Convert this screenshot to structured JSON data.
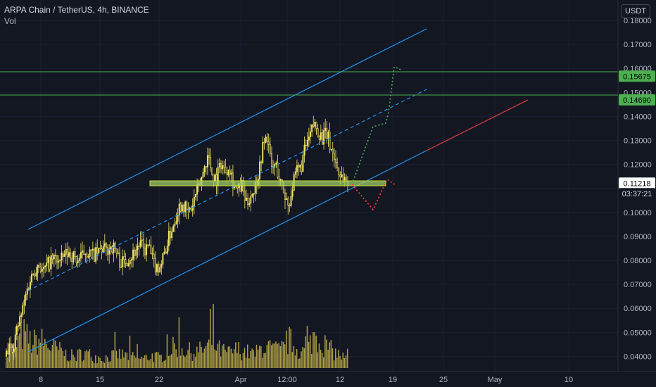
{
  "header": {
    "symbol_line": "ARPA Chain / TetherUS, 4h, BINANCE",
    "volume_label": "Vol"
  },
  "price_scale": {
    "unit": "USDT",
    "ticks": [
      "0.18000",
      "0.17000",
      "0.16000",
      "0.15000",
      "0.14000",
      "0.13000",
      "0.12000",
      "0.11000",
      "0.10000",
      "0.09000",
      "0.08000",
      "0.07000",
      "0.06000",
      "0.05000",
      "0.04000"
    ],
    "ylim": [
      0.035,
      0.18
    ]
  },
  "time_scale": {
    "ticks": [
      "8",
      "15",
      "22",
      "Apr",
      "12:00",
      "12",
      "19",
      "25",
      "May",
      "10"
    ]
  },
  "badges": [
    {
      "label": "0.15675",
      "value": 0.15675,
      "color": "#4caf50",
      "text_color": "#000000"
    },
    {
      "label": "0.14690",
      "value": 0.1469,
      "color": "#4caf50",
      "text_color": "#000000"
    },
    {
      "label": "0.11218",
      "value": 0.11218,
      "color": "#ffffff",
      "text_color": "#000000"
    },
    {
      "label": "03:37:21",
      "value": 0.1078,
      "color": "#131722",
      "text_color": "#d1d4dc"
    }
  ],
  "colors": {
    "background": "#131722",
    "candles": "#f5e663",
    "volume": "#c8b44a",
    "channel": "#2196f3",
    "horizontal_levels": "#4caf50",
    "support_zone": "#9ccc65",
    "projection_up": "#4caf50",
    "projection_down": "#f44336",
    "extension": "#f44336"
  },
  "chart_data": {
    "type": "candlestick",
    "symbol": "ARPA Chain / TetherUS",
    "interval": "4h",
    "exchange": "BINANCE",
    "price_range": [
      0.035,
      0.18
    ],
    "last_price": 0.11218,
    "countdown": "03:37:21",
    "price_path": [
      [
        0,
        0.04
      ],
      [
        0.5,
        0.043
      ],
      [
        1,
        0.045
      ],
      [
        1.5,
        0.052
      ],
      [
        2,
        0.058
      ],
      [
        2.5,
        0.066
      ],
      [
        3,
        0.072
      ],
      [
        3.5,
        0.076
      ],
      [
        4,
        0.079
      ],
      [
        4.5,
        0.075
      ],
      [
        5,
        0.078
      ],
      [
        5.5,
        0.08
      ],
      [
        6,
        0.081
      ],
      [
        6.5,
        0.079
      ],
      [
        7,
        0.082
      ],
      [
        7.5,
        0.083
      ],
      [
        8,
        0.082
      ],
      [
        8.5,
        0.08
      ],
      [
        9,
        0.081
      ],
      [
        9.5,
        0.084
      ],
      [
        10,
        0.083
      ],
      [
        10.5,
        0.082
      ],
      [
        11,
        0.083
      ],
      [
        11.5,
        0.085
      ],
      [
        12,
        0.084
      ],
      [
        12.5,
        0.086
      ],
      [
        13,
        0.085
      ],
      [
        13.5,
        0.08
      ],
      [
        14,
        0.079
      ],
      [
        14.5,
        0.081
      ],
      [
        15,
        0.082
      ],
      [
        15.5,
        0.085
      ],
      [
        16,
        0.087
      ],
      [
        16.5,
        0.084
      ],
      [
        17,
        0.086
      ],
      [
        17.5,
        0.079
      ],
      [
        18,
        0.077
      ],
      [
        18.5,
        0.079
      ],
      [
        19,
        0.085
      ],
      [
        19.5,
        0.091
      ],
      [
        20,
        0.096
      ],
      [
        20.5,
        0.102
      ],
      [
        21,
        0.104
      ],
      [
        21.5,
        0.1
      ],
      [
        22,
        0.101
      ],
      [
        22.5,
        0.107
      ],
      [
        23,
        0.111
      ],
      [
        23.5,
        0.118
      ],
      [
        24,
        0.124
      ],
      [
        24.5,
        0.116
      ],
      [
        25,
        0.114
      ],
      [
        25.5,
        0.121
      ],
      [
        26,
        0.117
      ],
      [
        26.5,
        0.12
      ],
      [
        27,
        0.112
      ],
      [
        27.5,
        0.109
      ],
      [
        28,
        0.111
      ],
      [
        28.5,
        0.103
      ],
      [
        29,
        0.107
      ],
      [
        29.5,
        0.11
      ],
      [
        30,
        0.117
      ],
      [
        30.5,
        0.128
      ],
      [
        31,
        0.132
      ],
      [
        31.5,
        0.118
      ],
      [
        32,
        0.12
      ],
      [
        32.5,
        0.113
      ],
      [
        33,
        0.108
      ],
      [
        33.5,
        0.103
      ],
      [
        34,
        0.111
      ],
      [
        34.5,
        0.117
      ],
      [
        35,
        0.119
      ],
      [
        35.5,
        0.127
      ],
      [
        36,
        0.131
      ],
      [
        36.5,
        0.137
      ],
      [
        37,
        0.134
      ],
      [
        37.5,
        0.131
      ],
      [
        38,
        0.133
      ],
      [
        38.5,
        0.127
      ],
      [
        39,
        0.122
      ],
      [
        39.5,
        0.116
      ],
      [
        40,
        0.115
      ],
      [
        40.5,
        0.112
      ]
    ],
    "volume_path": [
      [
        0,
        0.2
      ],
      [
        1,
        0.35
      ],
      [
        2,
        0.55
      ],
      [
        3,
        0.4
      ],
      [
        4,
        0.45
      ],
      [
        5,
        0.35
      ],
      [
        6,
        0.3
      ],
      [
        7,
        0.22
      ],
      [
        8,
        0.18
      ],
      [
        9,
        0.25
      ],
      [
        10,
        0.2
      ],
      [
        11,
        0.15
      ],
      [
        12,
        0.18
      ],
      [
        13,
        0.22
      ],
      [
        14,
        0.2
      ],
      [
        15,
        0.17
      ],
      [
        16,
        0.15
      ],
      [
        17,
        0.2
      ],
      [
        18,
        0.16
      ],
      [
        19,
        0.3
      ],
      [
        20,
        0.35
      ],
      [
        21,
        0.28
      ],
      [
        22,
        0.25
      ],
      [
        23,
        0.3
      ],
      [
        24,
        0.4
      ],
      [
        25,
        0.28
      ],
      [
        26,
        0.24
      ],
      [
        27,
        0.3
      ],
      [
        28,
        0.26
      ],
      [
        29,
        0.22
      ],
      [
        30,
        0.35
      ],
      [
        31,
        0.3
      ],
      [
        32,
        0.28
      ],
      [
        33,
        0.45
      ],
      [
        34,
        0.3
      ],
      [
        35,
        0.25
      ],
      [
        36,
        0.55
      ],
      [
        37,
        0.4
      ],
      [
        38,
        0.28
      ],
      [
        39,
        0.2
      ],
      [
        40,
        0.12
      ]
    ],
    "horizontal_levels": [
      0.15675,
      0.1469
    ],
    "support_zone": [
      0.1092,
      0.1107
    ]
  }
}
